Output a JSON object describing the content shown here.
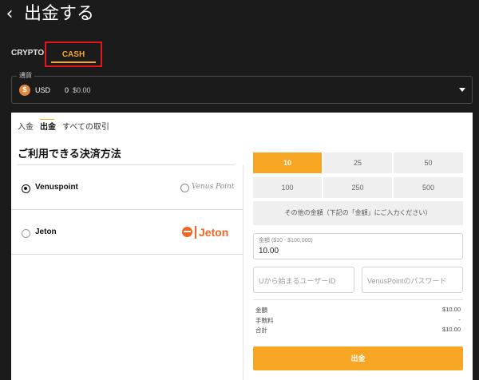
{
  "header": {
    "back_icon": "chevron-left-icon",
    "back_glyph": "‹",
    "title": "出金する"
  },
  "asset_tabs": {
    "crypto": "CRYPTO",
    "cash": "CASH"
  },
  "currency_select": {
    "legend": "通貨",
    "coin_icon": "dollar-coin-icon",
    "coin_glyph": "$",
    "code": "USD",
    "balance": "0",
    "amount": "$0.00",
    "accent": "#e0893a"
  },
  "panel": {
    "subtabs": [
      "入金",
      "出金",
      "すべての取引"
    ],
    "methods_title": "ご利用できる決済方法",
    "methods": [
      {
        "name": "Venuspoint",
        "logo_text": "Venus Point",
        "selected": true
      },
      {
        "name": "Jeton",
        "logo_text": "Jeton",
        "selected": false
      }
    ],
    "amounts": [
      "10",
      "25",
      "50",
      "100",
      "250",
      "500"
    ],
    "selected_amount": "10",
    "other_amount": "その他の金額（下記の「金額」にご入力ください）",
    "amount_field": {
      "legend": "金額 ($10 - $100,000)",
      "value": "10.00"
    },
    "user_field_placeholder": "Uから始まるユーザーID",
    "password_field_placeholder": "VenusPointのパスワード",
    "summary": [
      {
        "label": "金額",
        "value": "$10.00"
      },
      {
        "label": "手数料",
        "value": "-"
      },
      {
        "label": "合計",
        "value": "$10.00"
      }
    ],
    "submit_label": "出金"
  },
  "colors": {
    "accent": "#f6a623",
    "highlight_box": "#e0161b",
    "background": "#1b1b1b",
    "jeton_brand": "#f26522"
  }
}
